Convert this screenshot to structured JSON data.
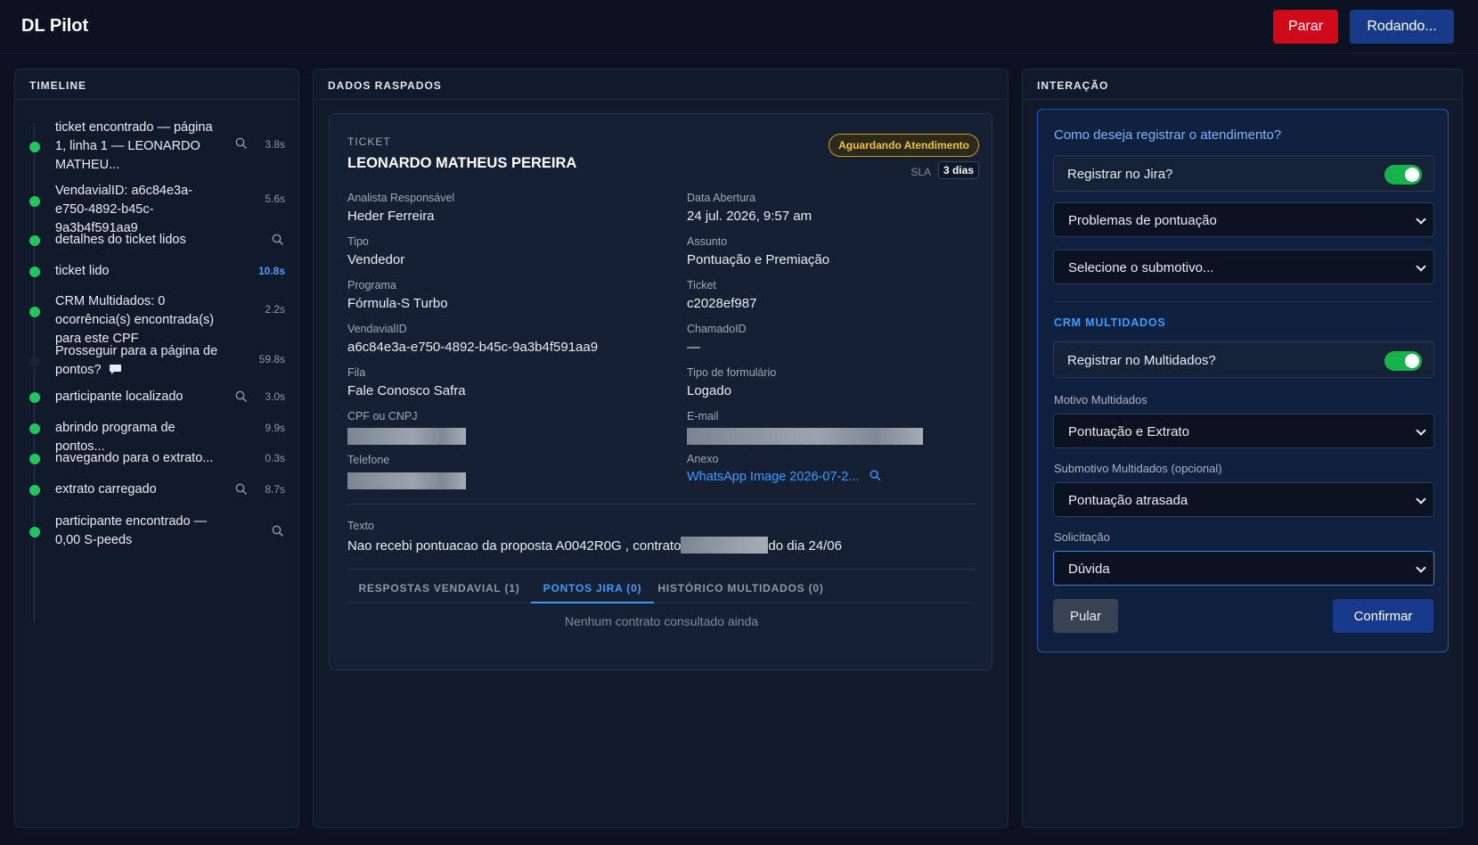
{
  "header": {
    "app_title": "DL Pilot",
    "stop_label": "Parar",
    "running_label": "Rodando..."
  },
  "timeline": {
    "title": "TIMELINE",
    "items": [
      {
        "text": "ticket encontrado — página 1, linha 1 — LEONARDO MATHEU...",
        "icon": "search-icon",
        "duration": "3.8s",
        "done": true
      },
      {
        "text": "VendavialID: a6c84e3a-e750-4892-b45c-9a3b4f591aa9",
        "icon": "",
        "duration": "5.6s",
        "done": true
      },
      {
        "text": "detalhes do ticket lidos",
        "icon": "search-icon",
        "duration": "",
        "done": true
      },
      {
        "text": "ticket lido",
        "icon": "",
        "duration": "10.8s",
        "done": true,
        "highlight": true
      },
      {
        "text": "CRM Multidados: 0 ocorrência(s) encontrada(s) para este CPF",
        "icon": "",
        "duration": "2.2s",
        "done": true
      },
      {
        "text": "Prosseguir para a página de pontos?",
        "icon": "chat-icon",
        "duration": "59.8s",
        "done": false
      },
      {
        "text": "participante localizado",
        "icon": "search-icon",
        "duration": "3.0s",
        "done": true
      },
      {
        "text": "abrindo programa de pontos...",
        "icon": "",
        "duration": "9.9s",
        "done": true
      },
      {
        "text": "navegando para o extrato...",
        "icon": "",
        "duration": "0.3s",
        "done": true
      },
      {
        "text": "extrato carregado",
        "icon": "search-icon",
        "duration": "8.7s",
        "done": true
      },
      {
        "text": "participante encontrado — 0,00 S-peeds",
        "icon": "search-icon",
        "duration": "",
        "done": true
      }
    ]
  },
  "data_panel": {
    "title": "DADOS RASPADOS",
    "ticket_kicker": "TICKET",
    "ticket_name": "LEONARDO MATHEUS PEREIRA",
    "status": "Aguardando Atendimento",
    "sla_label": "SLA",
    "sla_value": "3 dias",
    "fields": {
      "analista_label": "Analista Responsável",
      "analista": "Heder Ferreira",
      "abertura_label": "Data Abertura",
      "abertura": "24 jul. 2026, 9:57 am",
      "tipo_label": "Tipo",
      "tipo": "Vendedor",
      "assunto_label": "Assunto",
      "assunto": "Pontuação e Premiação",
      "programa_label": "Programa",
      "programa": "Fórmula-S Turbo",
      "ticket_label": "Ticket",
      "ticket": "c2028ef987",
      "vendavial_label": "VendavialID",
      "vendavial": "a6c84e3a-e750-4892-b45c-9a3b4f591aa9",
      "chamado_label": "ChamadoID",
      "chamado": "—",
      "fila_label": "Fila",
      "fila": "Fale Conosco Safra",
      "formulario_label": "Tipo de formulário",
      "formulario": "Logado",
      "cpf_label": "CPF ou CNPJ",
      "email_label": "E-mail",
      "telefone_label": "Telefone",
      "anexo_label": "Anexo",
      "anexo": "WhatsApp Image 2026-07-2..."
    },
    "texto_label": "Texto",
    "texto_before": "Nao recebi pontuacao da proposta A0042R0G , contrato",
    "texto_after": "do dia 24/06",
    "tabs": [
      {
        "label": "RESPOSTAS VENDAVIAL (1)",
        "active": false
      },
      {
        "label": "PONTOS JIRA (0)",
        "active": true
      },
      {
        "label": "HISTÓRICO MULTIDADOS (0)",
        "active": false
      }
    ],
    "empty_note": "Nenhum contrato consultado ainda"
  },
  "interaction": {
    "title": "INTERAÇÃO",
    "question": "Como deseja registrar o atendimento?",
    "jira_toggle_label": "Registrar no Jira?",
    "jira_enabled": true,
    "motivo_value": "Problemas de pontuação",
    "submotivo_value": "Selecione o submotivo...",
    "crm_section": "CRM MULTIDADOS",
    "multidados_toggle_label": "Registrar no Multidados?",
    "multidados_enabled": true,
    "motivo_multidados_label": "Motivo Multidados",
    "motivo_multidados_value": "Pontuação e Extrato",
    "submotivo_multidados_label": "Submotivo Multidados (opcional)",
    "submotivo_multidados_value": "Pontuação atrasada",
    "solicitacao_label": "Solicitação",
    "solicitacao_value": "Dúvida",
    "skip_label": "Pular",
    "confirm_label": "Confirmar"
  },
  "colors": {
    "accent": "#3b9bff",
    "success": "#22c55e",
    "danger": "#d0091b",
    "primary": "#173a8a",
    "warning": "#f2c230"
  }
}
